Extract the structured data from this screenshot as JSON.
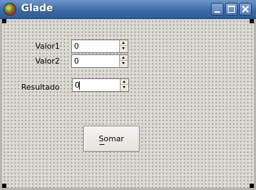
{
  "window": {
    "title": "Glade",
    "icon": "glade-icon",
    "controls": [
      "minimize-icon",
      "maximize-icon",
      "close-icon"
    ]
  },
  "form": {
    "valor1": {
      "label": "Valor1",
      "value": "0"
    },
    "valor2": {
      "label": "Valor2",
      "value": "0"
    },
    "resultado": {
      "label": "Resultado",
      "value": "0"
    },
    "somar_button": {
      "label": "Somar",
      "mnemonic": "S"
    }
  },
  "colors": {
    "titlebar": "#3e6aa8",
    "window_bg": "#dcdad5",
    "grid_dot": "#8f8d88",
    "handles": "#000000"
  }
}
